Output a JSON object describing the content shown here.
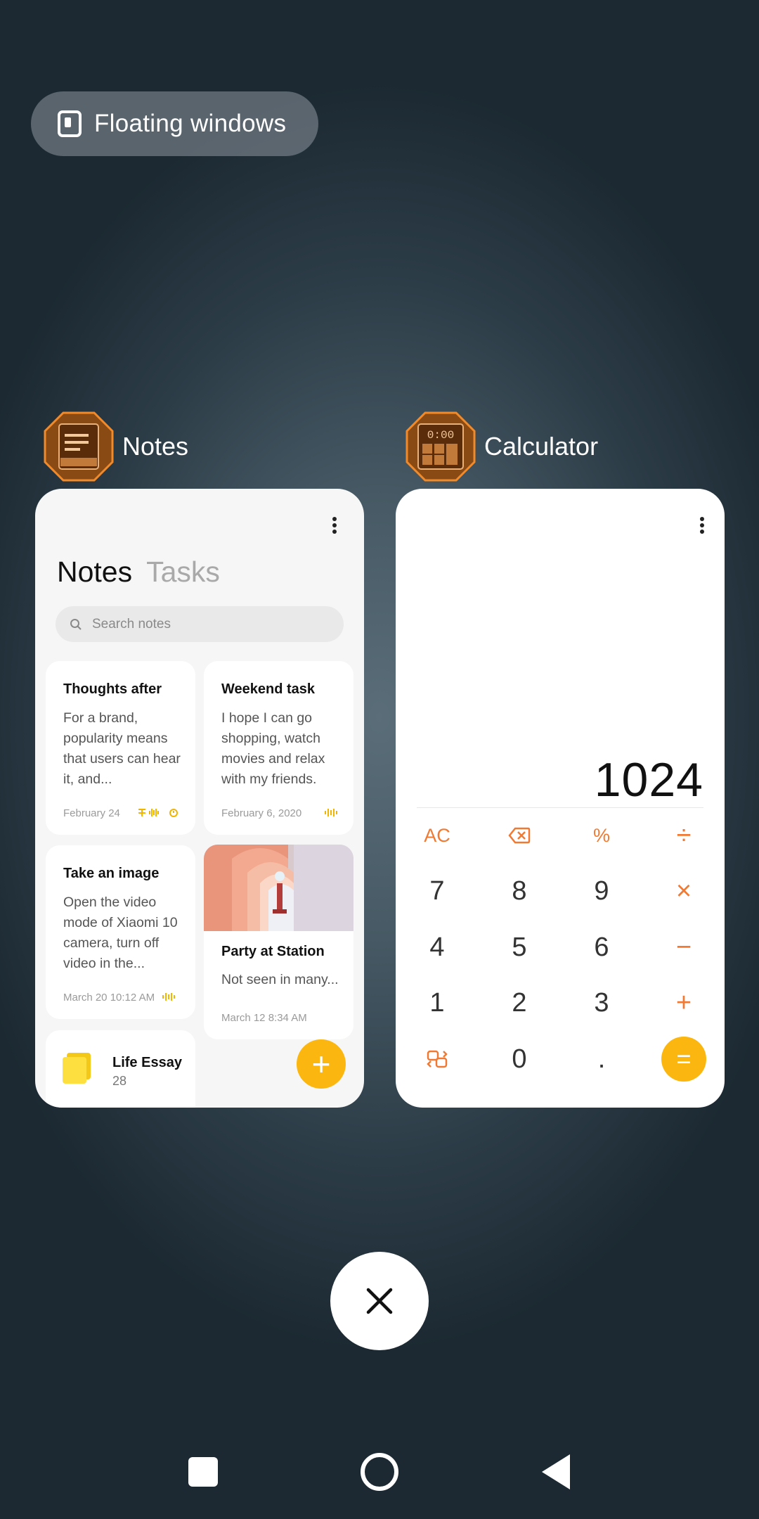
{
  "floating": {
    "label": "Floating windows"
  },
  "apps": [
    {
      "name": "Notes"
    },
    {
      "name": "Calculator"
    }
  ],
  "notes_app": {
    "tabs": [
      "Notes",
      "Tasks"
    ],
    "search_placeholder": "Search notes",
    "notes": [
      {
        "title": "Thoughts after",
        "body": "For a brand, popularity means that users can hear it, and...",
        "date": "February 24"
      },
      {
        "title": "Weekend task",
        "body": "I hope I can go shopping, watch movies and relax with my friends.",
        "date": "February 6, 2020"
      },
      {
        "title": "Take an image",
        "body": "Open the video mode of Xiaomi 10 camera, turn off video in the...",
        "date": "March 20 10:12 AM"
      },
      {
        "title": "Party at Station",
        "body": "Not seen in many...",
        "date": "March 12 8:34 AM"
      }
    ],
    "folder": {
      "name": "Life Essay",
      "count": "28"
    },
    "fab": "+"
  },
  "calc_app": {
    "display": "1024",
    "keys": {
      "ac": "AC",
      "percent": "%",
      "divide": "÷",
      "seven": "7",
      "eight": "8",
      "nine": "9",
      "multiply": "×",
      "four": "4",
      "five": "5",
      "six": "6",
      "minus": "−",
      "one": "1",
      "two": "2",
      "three": "3",
      "plus": "+",
      "zero": "0",
      "dot": ".",
      "equals": "="
    }
  },
  "colors": {
    "accent": "#fbb70f",
    "operator": "#f07a33"
  }
}
